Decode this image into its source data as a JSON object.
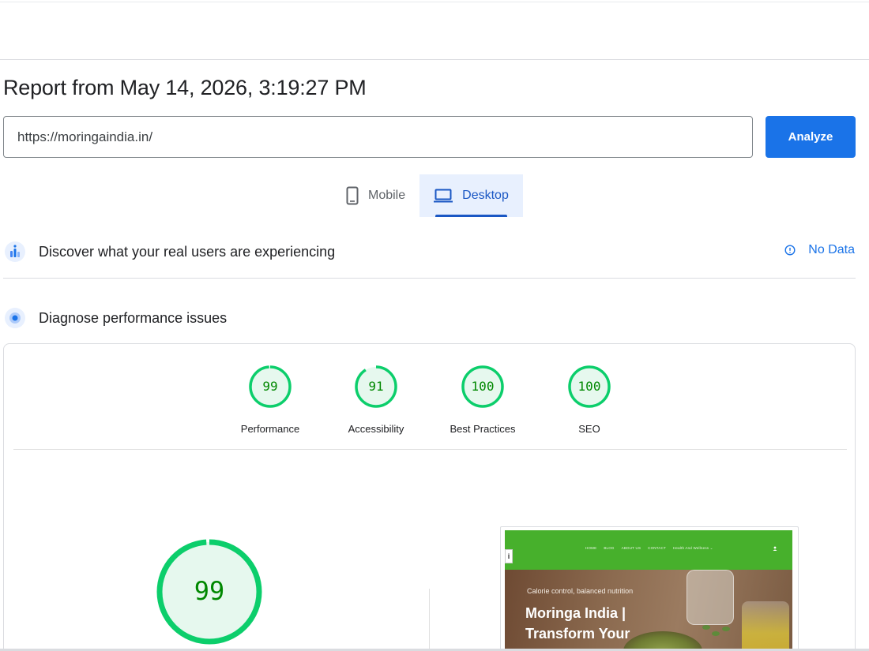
{
  "report": {
    "title": "Report from May 14, 2026, 3:19:27 PM"
  },
  "url_input": {
    "value": "https://moringaindia.in/"
  },
  "analyze_button": {
    "label": "Analyze",
    "color": "#1a73e8"
  },
  "device_tabs": [
    {
      "label": "Mobile",
      "icon": "phone-icon",
      "active": false
    },
    {
      "label": "Desktop",
      "icon": "laptop-icon",
      "active": true
    }
  ],
  "crux_section": {
    "icon": "crux-users-icon",
    "label": "Discover what your real users are experiencing",
    "status_icon": "info-icon",
    "status": "No Data"
  },
  "diagnose_section": {
    "icon": "lighthouse-icon",
    "label": "Diagnose performance issues"
  },
  "scores": [
    {
      "label": "Performance",
      "value": "99",
      "fraction": 0.99
    },
    {
      "label": "Accessibility",
      "value": "91",
      "fraction": 0.91
    },
    {
      "label": "Best Practices",
      "value": "100",
      "fraction": 1.0
    },
    {
      "label": "SEO",
      "value": "100",
      "fraction": 1.0
    }
  ],
  "main_score": {
    "value": "99",
    "fraction": 0.99
  },
  "colors": {
    "pass_green": "#0cce6b",
    "pass_green_text": "#008800",
    "pass_fill": "#e6f8ee",
    "accent_blue": "#1a73e8"
  },
  "site_preview": {
    "nav_items": [
      "HOME",
      "BLOG",
      "ABOUT US",
      "CONTACT",
      "Health And Wellness ⌄"
    ],
    "subheading": "Calorie control, balanced nutrition",
    "heading": "Moringa India | Transform Your",
    "nav_color": "#47b02c"
  }
}
